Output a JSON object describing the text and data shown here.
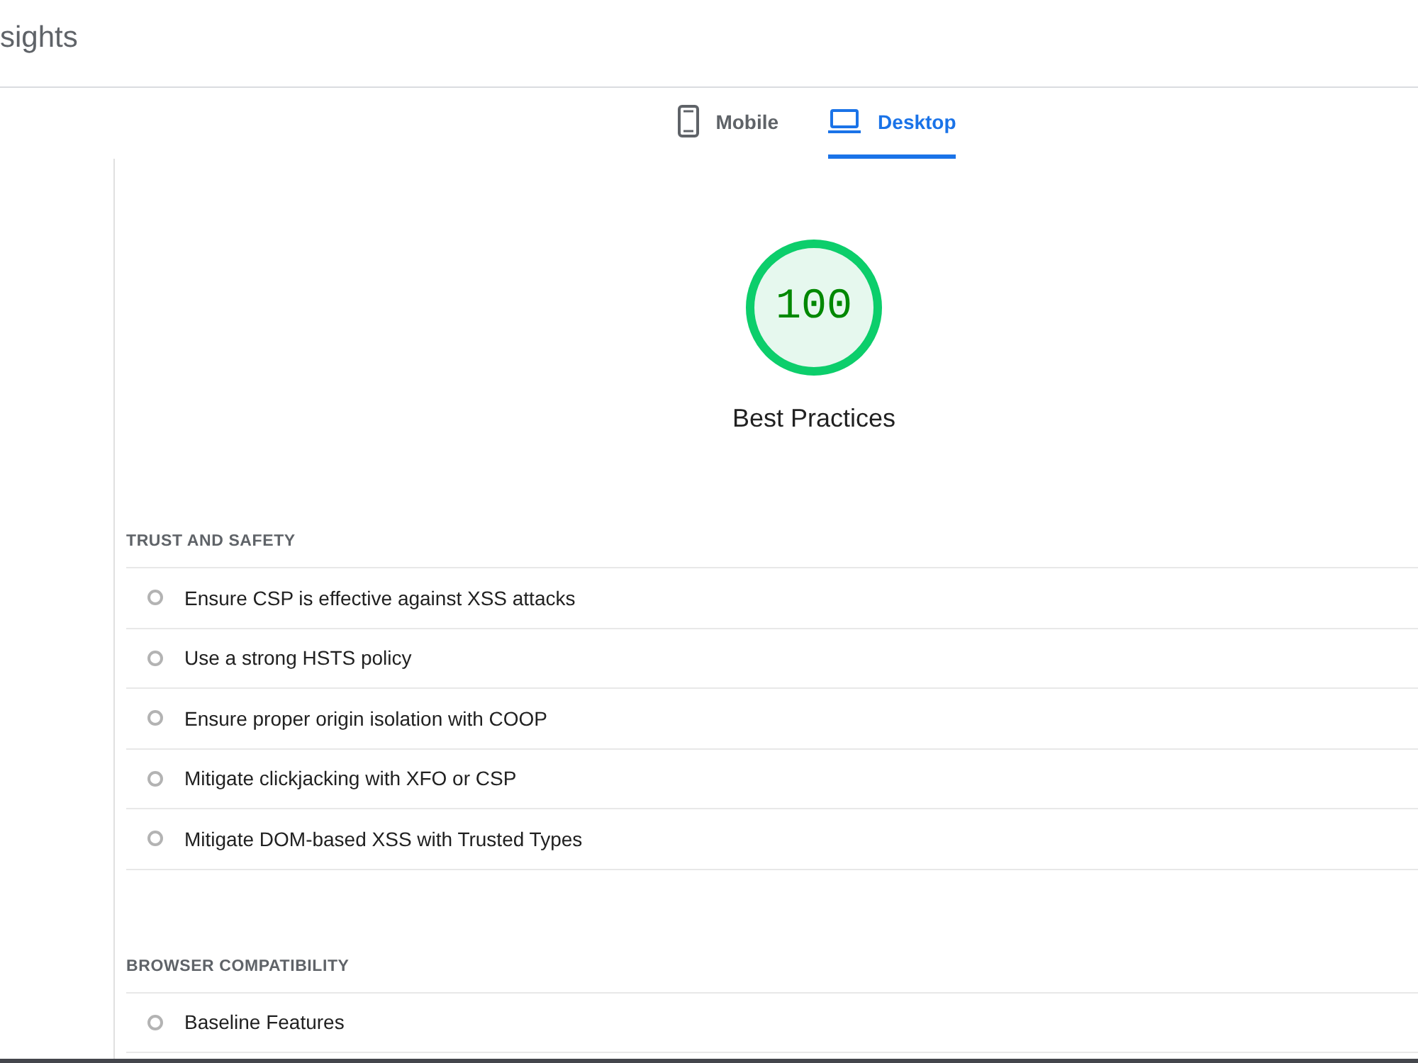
{
  "header": {
    "title": "sights"
  },
  "tabs": [
    {
      "label": "Mobile",
      "selected": false
    },
    {
      "label": "Desktop",
      "selected": true
    }
  ],
  "score": {
    "value": "100",
    "level": 1,
    "label": "Best Practices"
  },
  "sections": [
    {
      "heading": "TRUST AND SAFETY",
      "audits": [
        "Ensure CSP is effective against XSS attacks",
        "Use a strong HSTS policy",
        "Ensure proper origin isolation with COOP",
        "Mitigate clickjacking with XFO or CSP",
        "Mitigate DOM-based XSS with Trusted Types"
      ]
    },
    {
      "heading": "BROWSER COMPATIBILITY",
      "audits": [
        "Baseline Features"
      ]
    }
  ]
}
